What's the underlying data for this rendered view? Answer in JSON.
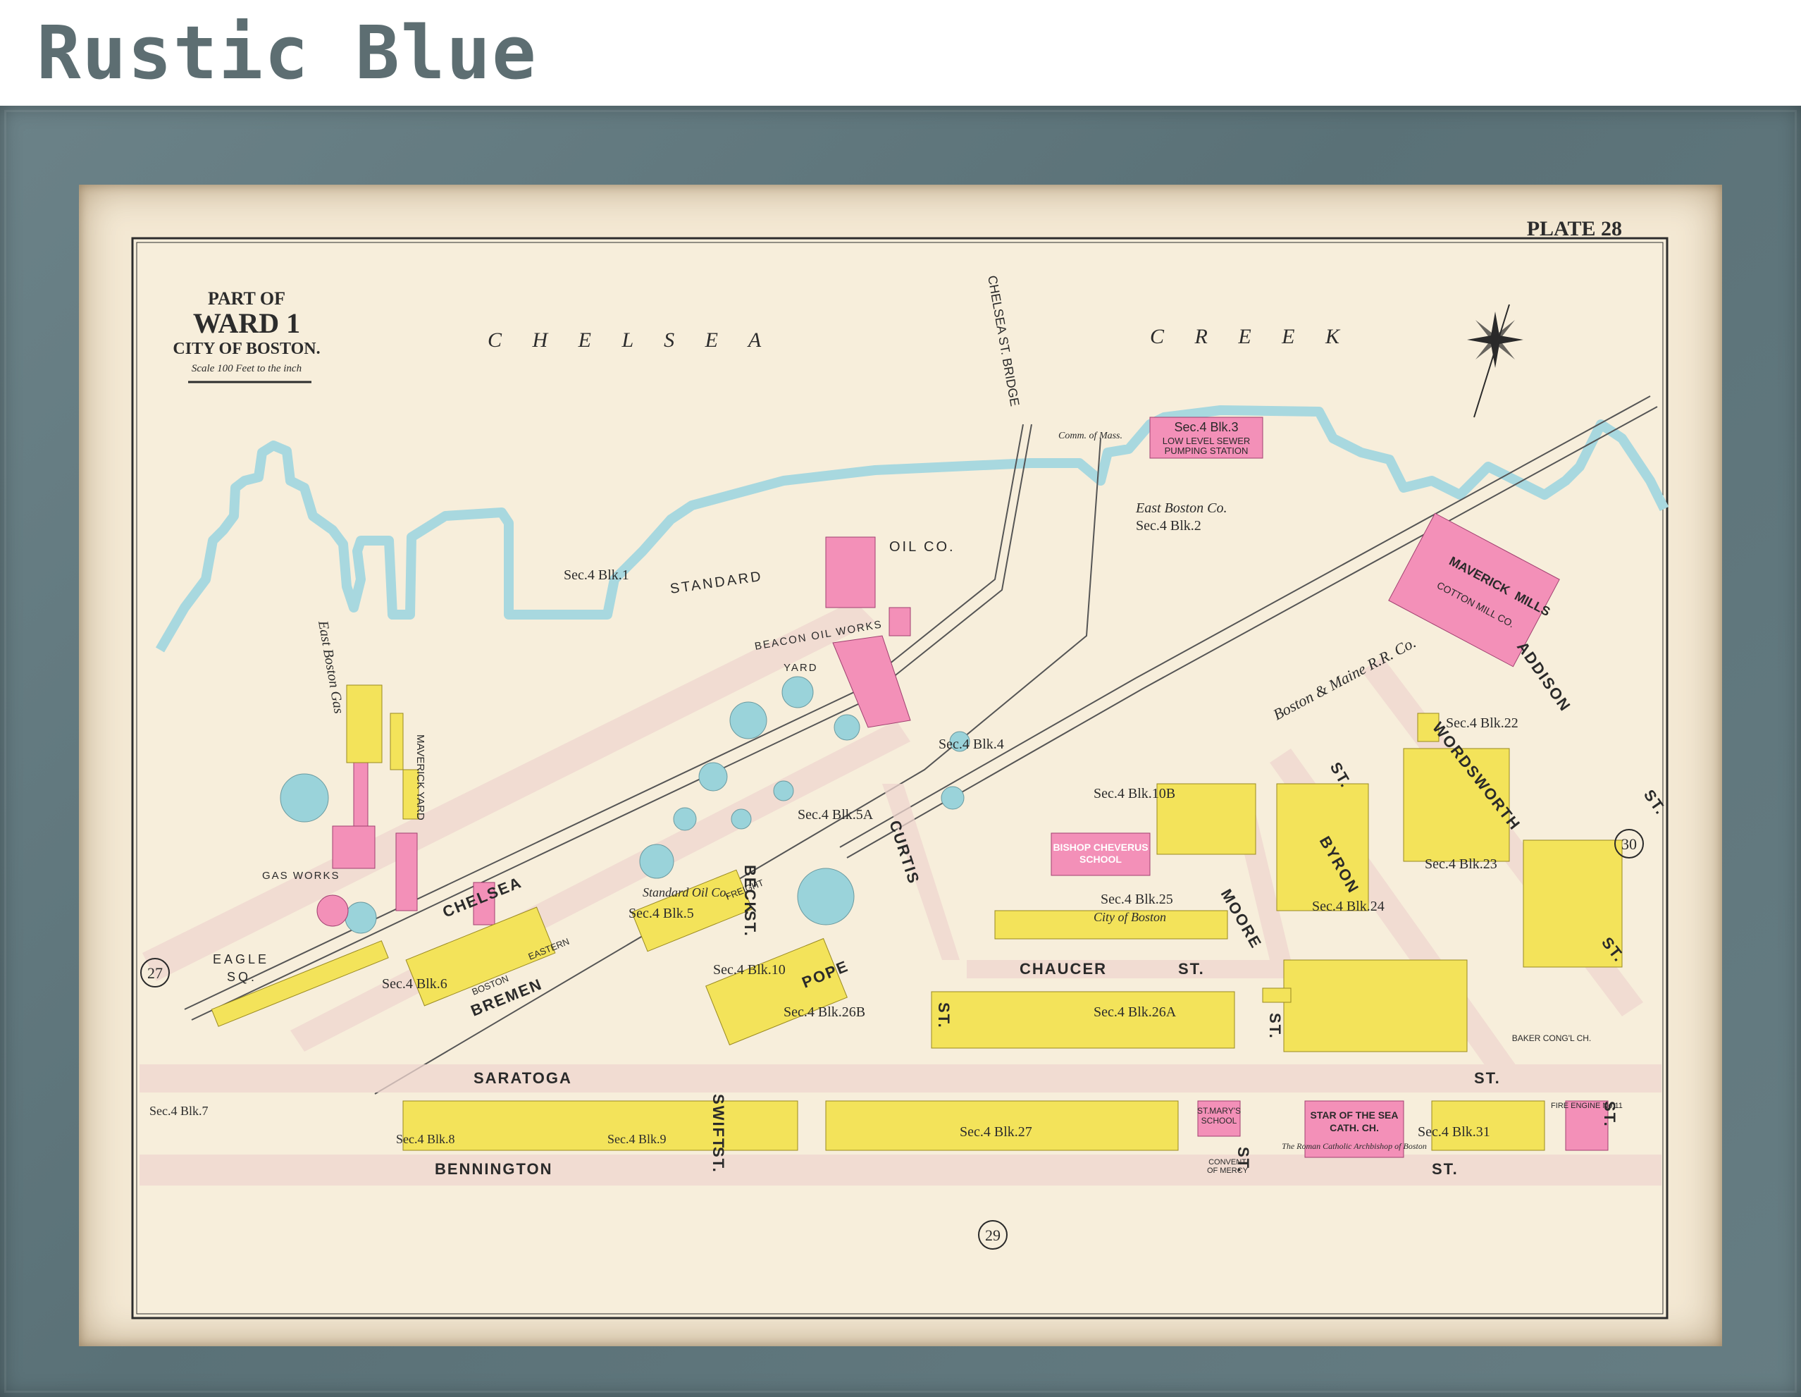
{
  "banner": {
    "title": "Rustic Blue"
  },
  "map": {
    "plate": "PLATE 28",
    "title_line1": "PART OF",
    "title_line2": "WARD 1",
    "title_line3": "CITY OF BOSTON.",
    "scale": "Scale 100 Feet to the inch",
    "water_chelsea": "C H E L S E A",
    "water_creek": "C R E E K",
    "labels": {
      "chelsea_st_bridge": "CHELSEA ST. BRIDGE",
      "standard_oil": "STANDARD",
      "oil_co": "OIL CO.",
      "beacon_oil": "BEACON OIL WORKS",
      "yard": "YARD",
      "east_boston_co": "East Boston Co.",
      "sec4blk1": "Sec.4 Blk.1",
      "sec4blk2": "Sec.4 Blk.2",
      "sec4blk3": "Sec.4 Blk.3",
      "comm_mass": "Comm. of Mass.",
      "pumping1": "LOW LEVEL SEWER",
      "pumping2": "PUMPING STATION",
      "sec4blk4": "Sec.4 Blk.4",
      "sec4blk5a": "Sec.4 Blk.5A",
      "sec4blk5": "Sec.4 Blk.5",
      "sec4blk6": "Sec.4 Blk.6",
      "sec4blk7": "Sec.4 Blk.7",
      "sec4blk8": "Sec.4 Blk.8",
      "sec4blk9": "Sec.4 Blk.9",
      "sec4blk10": "Sec.4 Blk.10",
      "sec4blk10b": "Sec.4 Blk.10B",
      "sec4blk22": "Sec.4 Blk.22",
      "sec4blk23": "Sec.4 Blk.23",
      "sec4blk24": "Sec.4 Blk.24",
      "sec4blk25": "Sec.4 Blk.25",
      "sec4blk26a": "Sec.4 Blk.26A",
      "sec4blk26b": "Sec.4 Blk.26B",
      "sec4blk27": "Sec.4 Blk.27",
      "sec4blk31": "Sec.4 Blk.31",
      "maverick_mills1": "MAVERICK",
      "maverick_mills2": "MILLS",
      "cotton_mill": "COTTON MILL CO.",
      "maverick_yard": "MAVERICK YARD",
      "east_boston_gas": "East Boston Gas",
      "gas_works": "GAS WORKS",
      "eagle_sq1": "EAGLE",
      "eagle_sq2": "SQ.",
      "standard_oil_co": "Standard Oil Co.",
      "bishop1": "BISHOP CHEVERUS",
      "bishop2": "SCHOOL",
      "city_of_boston": "City of Boston",
      "star1": "STAR OF THE SEA",
      "star2": "CATH. CH.",
      "roman": "The Roman Catholic Archbishop of Boston",
      "st_marys1": "ST.MARY'S",
      "st_marys2": "SCHOOL",
      "convent1": "CONVENT",
      "convent2": "OF MERCY",
      "baker": "BAKER CONG'L CH.",
      "fire_engine": "FIRE ENGINE No.11",
      "boston_maine": "Boston & Maine R.R. Co."
    },
    "streets": {
      "chelsea": "CHELSEA",
      "bremen": "BREMEN",
      "pope": "POPE",
      "saratoga": "SARATOGA",
      "saratoga_st": "ST.",
      "bennington": "BENNINGTON",
      "bennington_st": "ST.",
      "chaucer": "CHAUCER",
      "chaucer_st": "ST.",
      "curtis": "CURTIS",
      "curtis_st": "ST.",
      "moore": "MOORE",
      "moore_st": "ST.",
      "byron": "BYRON",
      "byron_st": "ST.",
      "addison": "ADDISON",
      "addison_st": "ST.",
      "wordsworth": "WORDSWORTH",
      "wordsworth_st": "ST.",
      "swift": "SWIFT",
      "swift_st": "ST.",
      "beck": "BECK",
      "beck_st": "ST.",
      "chaucer_end": "ST.",
      "st_left": "ST.",
      "eastern": "EASTERN",
      "freight": "FREIGHT",
      "boston": "BOSTON"
    },
    "plate_refs": {
      "left": "27",
      "bottom": "29",
      "right": "30"
    },
    "colors": {
      "paper": "#f5ecd6",
      "water_edge": "#9ed4dc",
      "brick": "#f08cb4",
      "frame": "#5f767c",
      "wood": "#f3e35a",
      "tank": "#8fd0d8"
    }
  }
}
